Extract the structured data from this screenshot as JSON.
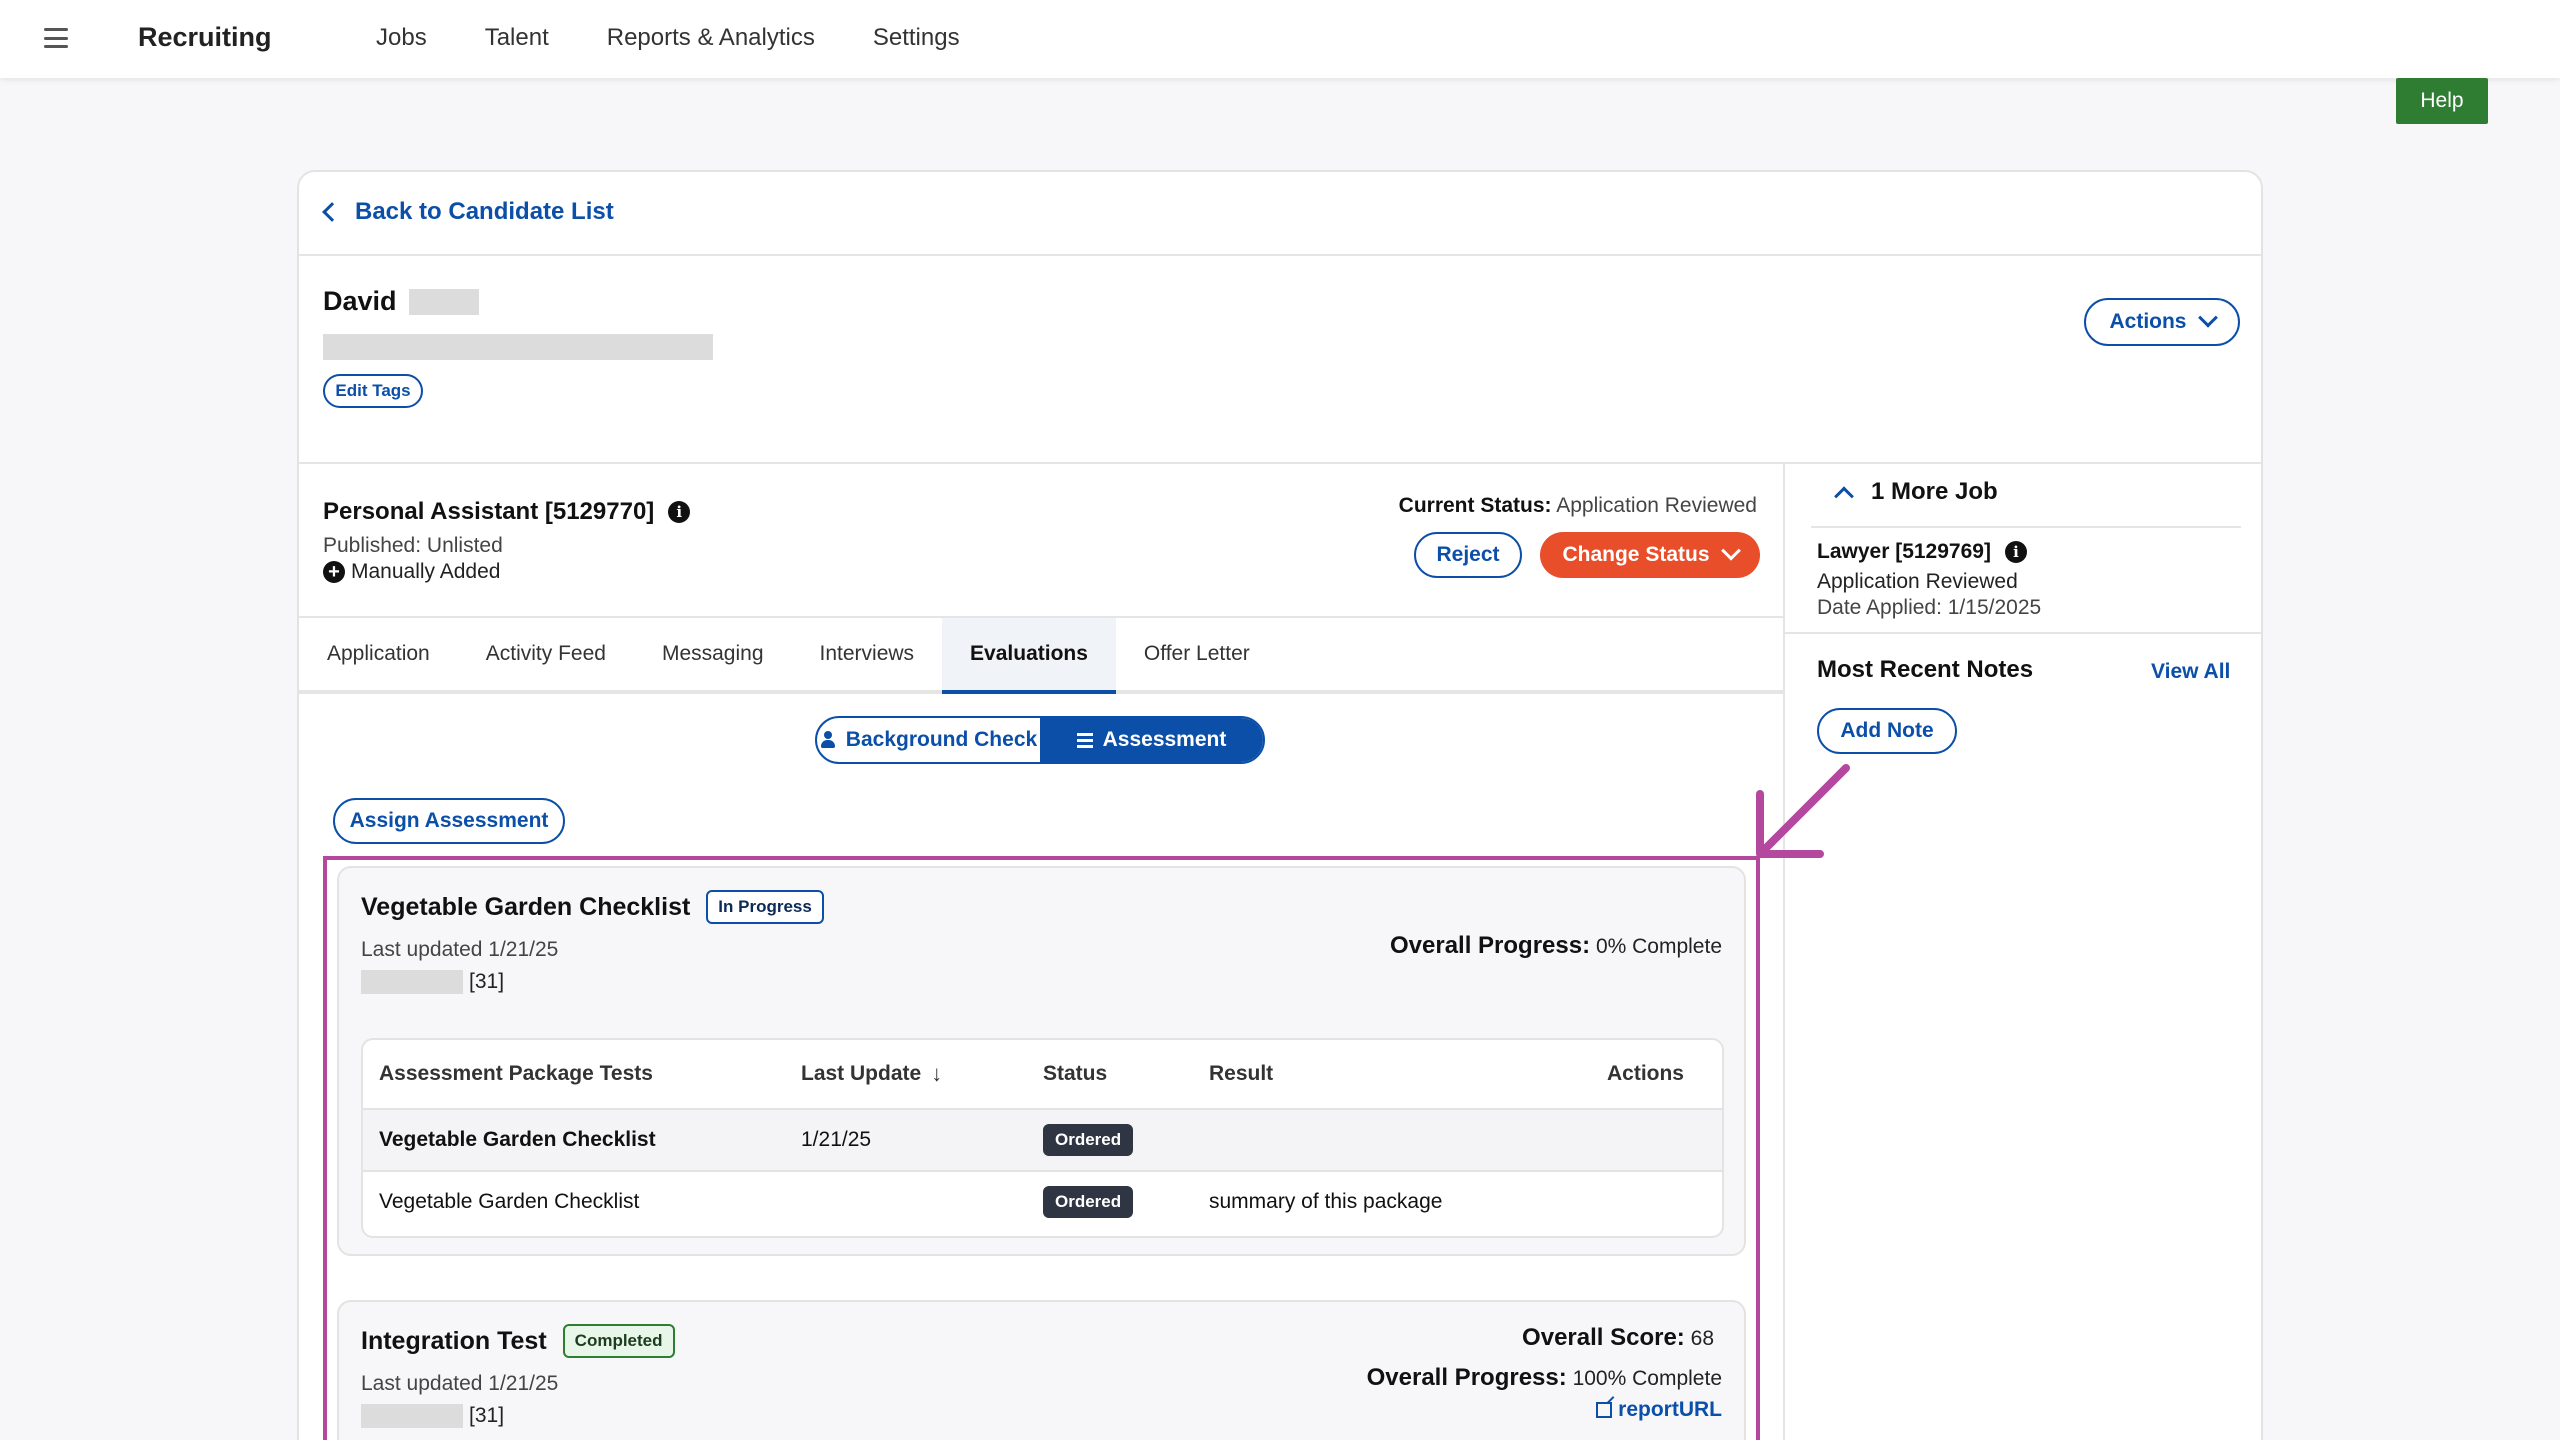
{
  "topbar": {
    "brand": "Recruiting",
    "nav": [
      "Jobs",
      "Talent",
      "Reports & Analytics",
      "Settings"
    ]
  },
  "help_label": "Help",
  "back_label": "Back to Candidate List",
  "candidate": {
    "first_name": "David",
    "edit_tags_label": "Edit Tags",
    "actions_label": "Actions"
  },
  "job": {
    "title": "Personal Assistant [5129770]",
    "published": "Published: Unlisted",
    "manual": "Manually Added",
    "current_status_label": "Current Status:",
    "current_status_value": "Application Reviewed",
    "reject_label": "Reject",
    "change_status_label": "Change Status"
  },
  "tabs": [
    "Application",
    "Activity Feed",
    "Messaging",
    "Interviews",
    "Evaluations",
    "Offer Letter"
  ],
  "segment": {
    "background_label": "Background Check",
    "assessment_label": "Assessment"
  },
  "assign_label": "Assign Assessment",
  "panel1": {
    "title": "Vegetable Garden Checklist",
    "badge": "In Progress",
    "updated": "Last updated 1/21/25",
    "owner_suffix": "[31]",
    "progress_label": "Overall Progress:",
    "progress_value": "0% Complete",
    "table": {
      "headers": [
        "Assessment Package Tests",
        "Last Update",
        "Status",
        "Result",
        "Actions"
      ],
      "rows": [
        {
          "name": "Vegetable Garden Checklist",
          "last_update": "1/21/25",
          "status": "Ordered",
          "result": ""
        },
        {
          "name": "Vegetable Garden Checklist",
          "last_update": "",
          "status": "Ordered",
          "result": "summary of this package"
        }
      ]
    }
  },
  "panel2": {
    "title": "Integration Test",
    "badge": "Completed",
    "updated": "Last updated 1/21/25",
    "owner_suffix": "[31]",
    "score_label": "Overall Score:",
    "score_value": "68",
    "progress_label": "Overall Progress:",
    "progress_value": "100% Complete",
    "report_label": "reportURL"
  },
  "sidebar": {
    "more_job_label": "1 More Job",
    "other_job_title": "Lawyer [5129769]",
    "other_job_status": "Application Reviewed",
    "other_job_date": "Date Applied: 1/15/2025",
    "notes_title": "Most Recent Notes",
    "view_all_label": "View All",
    "add_note_label": "Add Note"
  },
  "colors": {
    "primary": "#0b4fa8",
    "danger": "#e94e2a",
    "help": "#2e7d32",
    "highlight": "#b4489f"
  }
}
